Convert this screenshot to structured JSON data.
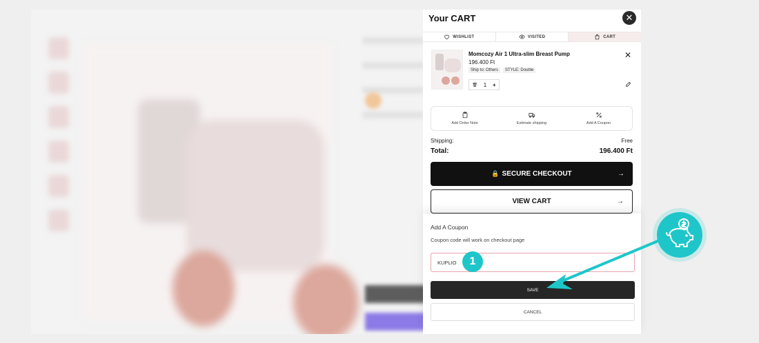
{
  "drawer": {
    "title": "Your CART",
    "close_symbol": "✕"
  },
  "tabs": [
    {
      "label": "WISHLIST",
      "icon": "heart-icon"
    },
    {
      "label": "VISITED",
      "icon": "eye-icon"
    },
    {
      "label": "CART",
      "icon": "bag-icon"
    }
  ],
  "item": {
    "name": "Momcozy Air 1 Ultra-slim Breast Pump",
    "price": "196.400 Ft",
    "ship_to": "Ship to: Others",
    "style": "STYLE: Double",
    "quantity": "1",
    "minus_symbol": "🗑",
    "plus_symbol": "+"
  },
  "actions": [
    {
      "label": "Add Order Note",
      "icon": "clipboard-icon"
    },
    {
      "label": "Estimate shipping",
      "icon": "truck-icon"
    },
    {
      "label": "Add A Coupon",
      "icon": "percent-icon"
    }
  ],
  "summary": {
    "shipping_label": "Shipping:",
    "shipping_value": "Free",
    "total_label": "Total:",
    "total_value": "196.400 Ft"
  },
  "buttons": {
    "checkout": "SECURE CHECKOUT",
    "view_cart": "VIEW CART",
    "arrow": "→"
  },
  "coupon": {
    "title": "Add A Coupon",
    "note": "Coupon code will work on checkout page",
    "value": "KUPLIO",
    "save": "SAVE",
    "cancel": "CANCEL"
  },
  "annotation": {
    "step": "1",
    "accent_color": "#1ec6c9"
  }
}
